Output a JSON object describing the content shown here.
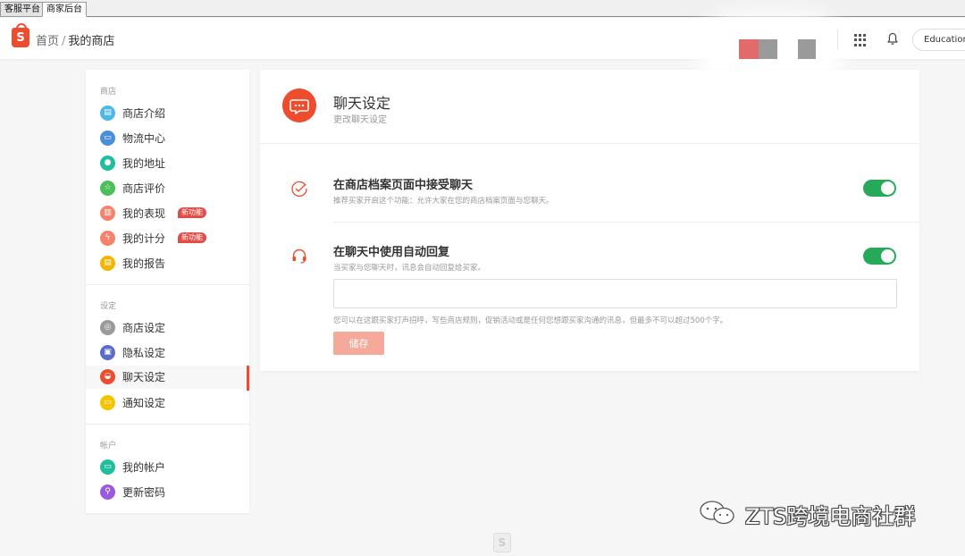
{
  "tabs": [
    {
      "label": "客服平台"
    },
    {
      "label": "商家后台"
    }
  ],
  "header": {
    "logo_letter": "S",
    "breadcrumb_home": "首页",
    "breadcrumb_sep": "/",
    "breadcrumb_current": "我的商店",
    "account_label": "Education"
  },
  "sidebar": {
    "shop_section": "商店",
    "shop_items": [
      {
        "label": "商店介绍",
        "icon": "shop-intro-icon",
        "color": "#4db8e8"
      },
      {
        "label": "物流中心",
        "icon": "truck-icon",
        "color": "#4a8fd8"
      },
      {
        "label": "我的地址",
        "icon": "location-icon",
        "color": "#1fbf9e"
      },
      {
        "label": "商店评价",
        "icon": "star-icon",
        "color": "#4bbf5a"
      },
      {
        "label": "我的表现",
        "icon": "performance-icon",
        "color": "#f5836b",
        "badge": "新功能"
      },
      {
        "label": "我的计分",
        "icon": "lightning-icon",
        "color": "#f5836b",
        "badge": "新功能"
      },
      {
        "label": "我的报告",
        "icon": "report-icon",
        "color": "#f5b400"
      }
    ],
    "settings_section": "设定",
    "settings_items": [
      {
        "label": "商店设定",
        "icon": "shop-settings-icon",
        "color": "#9a9a9a"
      },
      {
        "label": "隐私设定",
        "icon": "lock-icon",
        "color": "#5a6bc8"
      },
      {
        "label": "聊天设定",
        "icon": "chat-icon",
        "color": "#ee4d2d"
      },
      {
        "label": "通知设定",
        "icon": "notification-icon",
        "color": "#f5c400"
      }
    ],
    "account_section": "帐户",
    "account_items": [
      {
        "label": "我的帐户",
        "icon": "account-icon",
        "color": "#1fbf9e"
      },
      {
        "label": "更新密码",
        "icon": "key-icon",
        "color": "#9a5ae0"
      }
    ]
  },
  "main": {
    "title": "聊天设定",
    "subtitle": "更改聊天设定",
    "setting1": {
      "title": "在商店档案页面中接受聊天",
      "desc": "推荐买家开启这个功能：允许大家在您的商店档案页面与您聊天。",
      "enabled": true
    },
    "setting2": {
      "title": "在聊天中使用自动回复",
      "desc": "当买家与您聊天时，讯息会自动回复给买家。",
      "enabled": true,
      "input_value": "",
      "hint": "您可以在这跟买家打声招呼，写些商店规则，促销活动或是任何您想跟买家沟通的讯息，但最多不可以超过500个字。",
      "save_label": "储存"
    }
  },
  "watermark": {
    "text": "ZTS跨境电商社群"
  },
  "colors": {
    "brand": "#ee4d2d",
    "toggle_on": "#26aa5a"
  }
}
